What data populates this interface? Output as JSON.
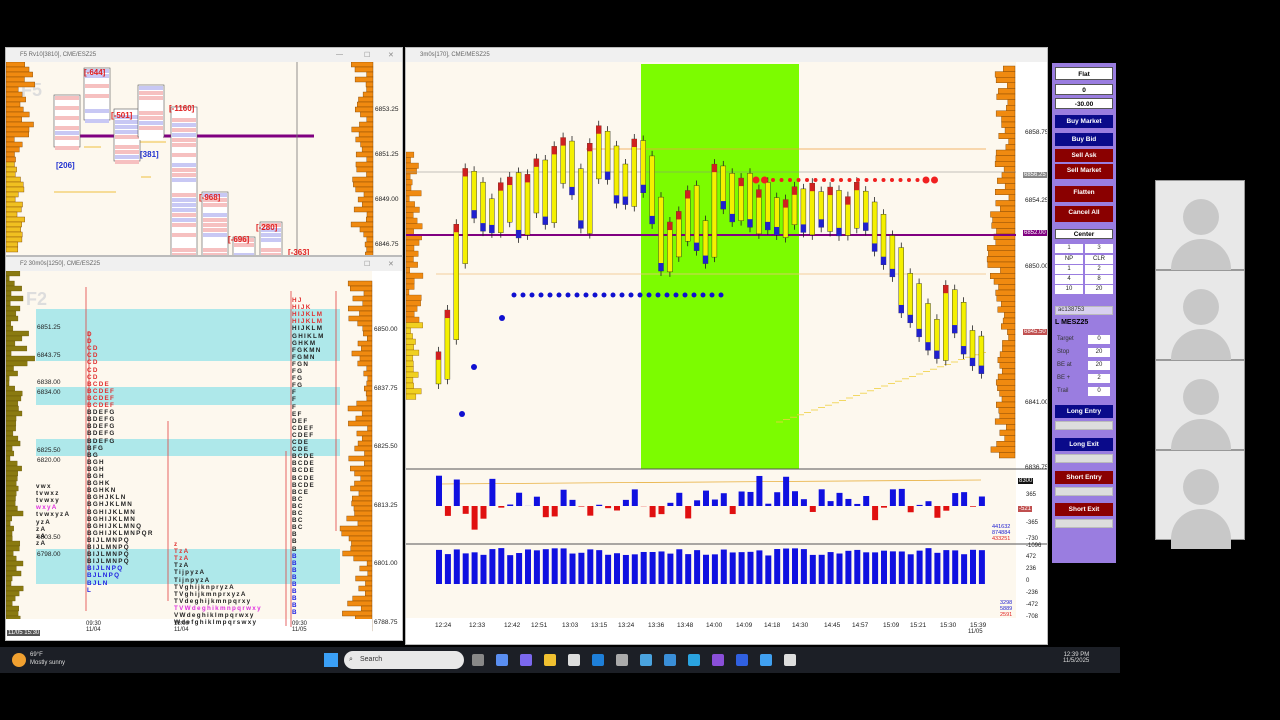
{
  "windows": {
    "f5": {
      "title": "F5 Rv10[3810], CME/ESZ25",
      "watermark": "F5",
      "prices": [
        "6853.25",
        "6851.25",
        "6849.00",
        "6846.75"
      ],
      "deltas": [
        "[-644]",
        "[-501]",
        "[-1160]",
        "[-968]",
        "[-696]",
        "[-280]",
        "[-363]"
      ],
      "pos_deltas": [
        "[206]",
        "[381]"
      ]
    },
    "f2": {
      "title": "F2 30m0s[1250], CME/ESZ25",
      "watermark": "F2",
      "prices": [
        "6850.00",
        "6837.75",
        "6825.50",
        "6813.25",
        "6801.00",
        "6788.75"
      ],
      "levels": [
        "6851.25",
        "6843.75",
        "6838.00",
        "6834.00",
        "6825.50",
        "6820.00",
        "6803.50",
        "6798.00"
      ],
      "times": [
        {
          "t": "09:30",
          "d": "11/04"
        },
        {
          "t": "18:00",
          "d": "11/04"
        },
        {
          "t": "09:30",
          "d": "11/05"
        }
      ],
      "cursor_time": "11/05 15:30",
      "tpo_left": [
        "D",
        "D",
        "CD",
        "CD",
        "CD",
        "CD",
        "CD",
        "BCDE",
        "BCDEF",
        "BCDEF",
        "BCDEF",
        "BDEFG",
        "BDEFG",
        "BDEFG",
        "BDEFG",
        "BDEFG",
        "BFG",
        "BG",
        "BGH",
        "BGH",
        "BGH",
        "BGHK",
        "BGHKN",
        "BGHJKLN",
        "BGHJKLMN",
        "BGHIJKLMN",
        "BGHIJKLMN",
        "BGHIJKLMNQ",
        "BGHIJKLMNPQR",
        "BIJLMNPQ",
        "BIJLMNPQ",
        "BIJLMNPQ",
        "BIJLMNPQ",
        "BIJLNPQ",
        "BJLNPQ",
        "BJLN",
        "L"
      ],
      "tpo_mid": [
        "z",
        "TzA",
        "TzA",
        "TzA",
        "TijpyzA",
        "TijnpyzA",
        "TVghijknpryzA",
        "TVghijkmnprxyzA",
        "TVdeghijkmnpqrxy",
        "TVWdeghikmnpqrwxy",
        "VWdeghiklmpqrwxy",
        "Wdefghiklmpqrswxy"
      ],
      "tpo_right": [
        "HJ",
        "HIJK",
        "HIJKLM",
        "HIJKLM",
        "HIJKLM",
        "GHIKLM",
        "GHKM",
        "FGKMN",
        "FGMN",
        "FGN",
        "FG",
        "FG",
        "FG",
        "F",
        "F",
        "F",
        "EF",
        "DEF",
        "CDEF",
        "CDEF",
        "CDE",
        "CDE",
        "BCDE",
        "BCDE",
        "BCDE",
        "BCDE",
        "BCDE",
        "BCE",
        "BC",
        "BC",
        "BC",
        "BC",
        "BC",
        "B",
        "B",
        "B",
        "B",
        "B",
        "B",
        "B",
        "B",
        "B",
        "B",
        "B",
        "B"
      ],
      "tpo_far": [
        "vwx",
        "tvwxz",
        "tvwxy",
        "wxyA",
        "tvwxyzA",
        "yzA",
        "zA",
        "zA",
        "zA"
      ]
    },
    "main": {
      "title": "3m0s[170], CME/MESZ25",
      "prices": [
        "6858.75",
        "6854.25",
        "6850.00",
        "6845.50",
        "6841.00",
        "6836.75"
      ],
      "tags": {
        "last": "6856.25",
        "poc": "6852.00",
        "current": "6845.50"
      },
      "ind_scale": [
        "365",
        "-365",
        "-730",
        "-1096"
      ],
      "ind_tags": {
        "top": "8300",
        "mid": "-521"
      },
      "ind_counts": [
        "441632",
        "874884",
        "433251"
      ],
      "vol_scale": [
        "472",
        "236",
        "0",
        "-236",
        "-472",
        "-708"
      ],
      "vol_counts": [
        "3298",
        "5889",
        "2591"
      ],
      "times": [
        "12:24",
        "12:33",
        "12:42",
        "12:51",
        "13:03",
        "13:15",
        "13:24",
        "13:36",
        "13:48",
        "14:00",
        "14:09",
        "14:18",
        "14:30",
        "14:45",
        "14:57",
        "15:09",
        "15:21",
        "15:30",
        "15:39"
      ],
      "last_date": "11/05",
      "cursor_time": "11/05 15:30"
    }
  },
  "panel": {
    "status": "Flat",
    "position": "0",
    "pnl": "-30.00",
    "buy_market": "Buy Market",
    "buy_bid": "Buy Bid",
    "sell_ask": "Sell Ask",
    "sell_market": "Sell Market",
    "flatten": "Flatten",
    "cancel_all": "Cancel All",
    "center": "Center",
    "qty": "1",
    "qty_right": "3",
    "grid": [
      "NP",
      "CLR",
      "1",
      "2",
      "4",
      "8",
      "10",
      "20"
    ],
    "account": "ac138753",
    "instrument": "L MESZ25",
    "fields": [
      {
        "label": "Target",
        "value": "0"
      },
      {
        "label": "Stop",
        "value": "20"
      },
      {
        "label": "BE at",
        "value": "20"
      },
      {
        "label": "BE +",
        "value": "2"
      },
      {
        "label": "Trail",
        "value": "0"
      }
    ],
    "long_entry": "Long Entry",
    "long_exit": "Long Exit",
    "short_entry": "Short Entry",
    "short_exit": "Short Exit"
  },
  "taskbar": {
    "temp": "69°F",
    "weather": "Mostly sunny",
    "search": "Search",
    "time": "12:39 PM",
    "date": "11/5/2025"
  }
}
